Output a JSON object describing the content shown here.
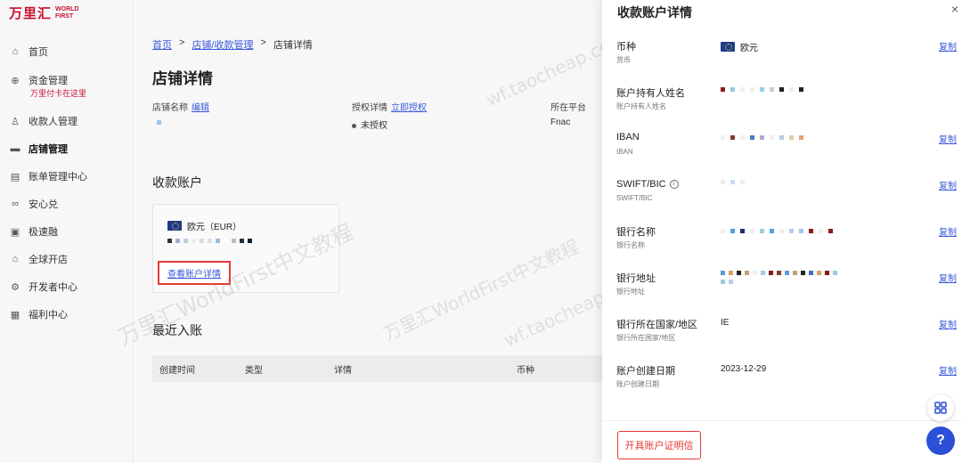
{
  "logo": {
    "cn": "万里汇",
    "en1": "WORLD",
    "en2": "FIRST"
  },
  "sidebar": {
    "items": [
      {
        "label": "首页",
        "icon": "home-icon",
        "glyph": "⌂"
      },
      {
        "label": "资金管理",
        "icon": "funds-icon",
        "glyph": "⊕"
      },
      {
        "label": "收款人管理",
        "icon": "user-icon",
        "glyph": "♙"
      },
      {
        "label": "店铺管理",
        "icon": "store-icon",
        "glyph": "▬"
      },
      {
        "label": "账单管理中心",
        "icon": "bill-icon",
        "glyph": "▤"
      },
      {
        "label": "安心兑",
        "icon": "exchange-icon",
        "glyph": "∞"
      },
      {
        "label": "极速融",
        "icon": "finance-icon",
        "glyph": "▣"
      },
      {
        "label": "全球开店",
        "icon": "global-store-icon",
        "glyph": "⌂"
      },
      {
        "label": "开发者中心",
        "icon": "developer-icon",
        "glyph": "⚙"
      },
      {
        "label": "福利中心",
        "icon": "gift-icon",
        "glyph": "▦"
      }
    ],
    "sub_note": "万里付卡在这里"
  },
  "breadcrumb": {
    "home": "首页",
    "store_mgmt": "店铺/收款管理",
    "current": "店铺详情",
    "sep": ">"
  },
  "page_title": "店铺详情",
  "store_info": {
    "name_label": "店铺名称",
    "name_edit": "编辑",
    "auth_label": "授权详情",
    "auth_link": "立即授权",
    "auth_status": "未授权",
    "platform_label": "所在平台",
    "platform_value": "Fnac"
  },
  "receiving_title": "收款账户",
  "account_card": {
    "currency": "欧元（EUR）",
    "view_link": "查看账户详情"
  },
  "recent_title": "最近入账",
  "table_headers": [
    "创建时间",
    "类型",
    "详情",
    "币种"
  ],
  "drawer": {
    "title": "收款账户详情",
    "close": "×",
    "copy_label": "复制",
    "rows": [
      {
        "label": "币种",
        "sub": "货币",
        "value": "欧元"
      },
      {
        "label": "账户持有人姓名",
        "sub": "账户持有人姓名",
        "value": ""
      },
      {
        "label": "IBAN",
        "sub": "IBAN",
        "value": ""
      },
      {
        "label": "SWIFT/BIC",
        "sub": "SWIFT/BIC",
        "value": ""
      },
      {
        "label": "银行名称",
        "sub": "银行名称",
        "value": ""
      },
      {
        "label": "银行地址",
        "sub": "银行地址",
        "value": ""
      },
      {
        "label": "银行所在国家/地区",
        "sub": "银行所在国家/地区",
        "value": "IE"
      },
      {
        "label": "账户创建日期",
        "sub": "账户创建日期",
        "value": "2023-12-29"
      }
    ],
    "cert_button": "开具账户证明信"
  },
  "floating": {
    "grid_icon": "grid-icon",
    "help_label": "?"
  },
  "watermarks": [
    "万里汇WorldFirst中文教程",
    "wf.taocheap.cc"
  ],
  "colors": {
    "brand": "#c8102e",
    "link": "#3b5bdb",
    "help": "#2b4fd8"
  }
}
